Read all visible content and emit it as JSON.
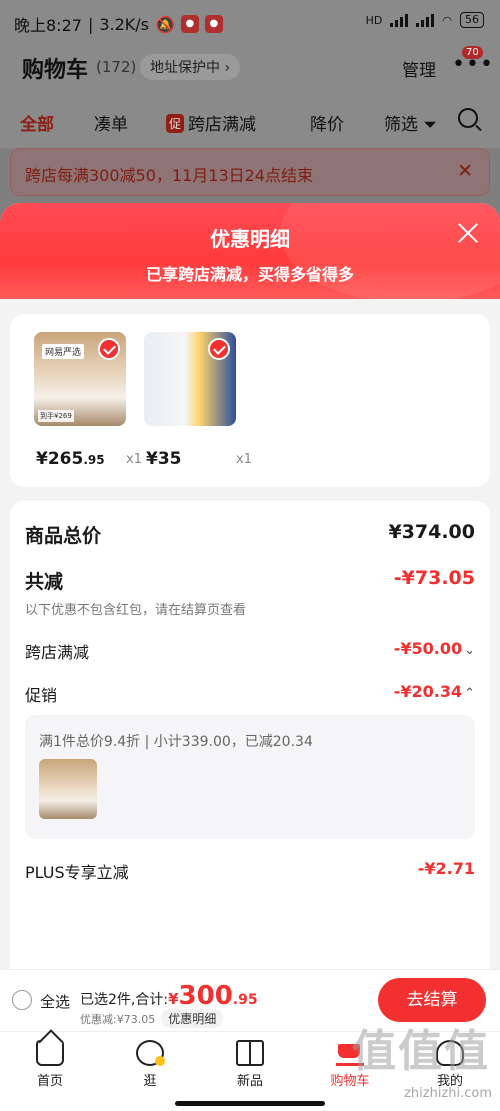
{
  "status_bar": {
    "time": "晚上8:27",
    "speed": "3.2K/s",
    "network": "HD",
    "battery": "56"
  },
  "header": {
    "title": "购物车",
    "count": "(172)",
    "address_protect": "地址保护中",
    "manage": "管理",
    "more_badge": "70"
  },
  "tabs": [
    {
      "label": "全部"
    },
    {
      "label": "凑单"
    },
    {
      "label": "跨店满减",
      "icon_text": "促"
    },
    {
      "label": "降价"
    },
    {
      "label": "筛选"
    }
  ],
  "notice": "跨店每满300减50，11月13日24点结束",
  "sheet": {
    "title": "优惠明细",
    "subtitle": "已享跨店满减，买得多省得多",
    "products": [
      {
        "price_int": "¥265",
        "price_dec": ".95",
        "qty": "x1",
        "brand_tag": "网易严选",
        "price_tag": "到手¥269"
      },
      {
        "price_int": "¥35",
        "price_dec": "",
        "qty": "x1"
      }
    ],
    "total_label": "商品总价",
    "total_value": "¥374.00",
    "discount_label": "共减",
    "discount_value": "-¥73.05",
    "discount_note": "以下优惠不包含红包，请在结算页查看",
    "cross_store_label": "跨店满减",
    "cross_store_value": "-¥50.00",
    "promo_label": "促销",
    "promo_value": "-¥20.34",
    "promo_detail": "满1件总价9.4折 | 小计339.00，已减20.34",
    "plus_label": "PLUS专享立减",
    "plus_value": "-¥2.71"
  },
  "checkout": {
    "select_all": "全选",
    "selected_text": "已选2件,合计:",
    "total_yen": "¥",
    "total_int": "300",
    "total_dec": ".95",
    "discount_text": "优惠减:¥73.05",
    "detail_btn": "优惠明细",
    "checkout_btn": "去结算"
  },
  "tabbar": [
    {
      "label": "首页",
      "icon": "home-icon"
    },
    {
      "label": "逛",
      "icon": "discover-icon"
    },
    {
      "label": "新品",
      "icon": "new-products-icon"
    },
    {
      "label": "购物车",
      "icon": "cart-icon"
    },
    {
      "label": "我的",
      "icon": "profile-icon"
    }
  ],
  "watermark": {
    "text": "zhizhizhi.com",
    "logo": "值值值"
  },
  "colors": {
    "accent": "#f23030",
    "sheet_header": "#ff4a55"
  }
}
